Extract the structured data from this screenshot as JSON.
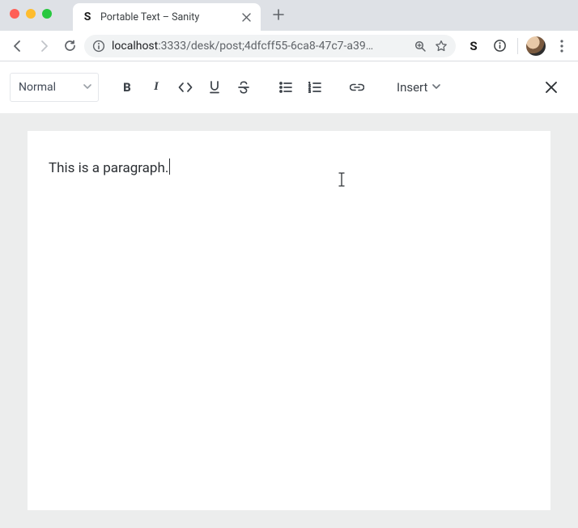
{
  "browser": {
    "tab": {
      "favicon_letter": "S",
      "title": "Portable Text – Sanity"
    },
    "url": {
      "host": "localhost",
      "rest": ":3333/desk/post;4dfcff55-6ca8-47c7-a39…"
    }
  },
  "toolbar": {
    "style_select": "Normal",
    "insert_label": "Insert"
  },
  "editor": {
    "paragraph": "This is a paragraph."
  }
}
